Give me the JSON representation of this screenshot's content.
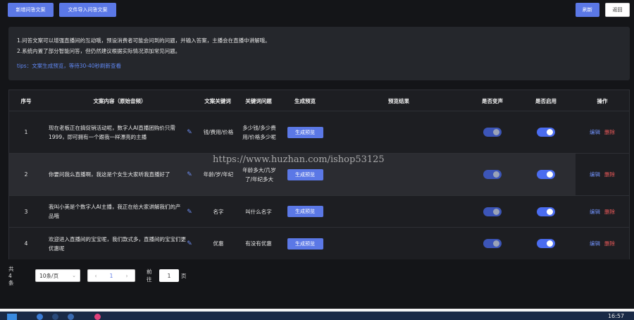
{
  "toolbar": {
    "add_label": "新增问答文案",
    "import_label": "文件导入问答文案",
    "refresh_label": "刷新",
    "back_label": "返回"
  },
  "info": {
    "line1": "1.问答文案可以增强直播间的互动哦，预设消费者可能会问到的问题，并输入答案，主播会在直播中讲解哦。",
    "line2": "2.系统内置了部分智能问答，但仍然建议根据实际情况添加常见问题。",
    "tips": "tips：文案生成预览，等待30-40秒刷新查看"
  },
  "table": {
    "headers": [
      "序号",
      "文案内容（原始音频）",
      "文案关键词",
      "关键词问题",
      "生成预览",
      "预览结果",
      "是否变声",
      "是否启用",
      "操作"
    ],
    "rows": [
      {
        "index": "1",
        "content": "现在老板正在搞促销活动呢，数字人AI直播团购价只需1999，即可拥有一个跟我一样漂亮的主播",
        "keyword": "钱/费用/价格",
        "question": "多少钱/多少费用/价格多少呢",
        "preview_btn": "生成预览",
        "voice_change": false,
        "enabled": true
      },
      {
        "index": "2",
        "content": "你要问我么直播啊，我这是个女生大家听我直播好了",
        "keyword": "年龄/岁/年纪",
        "question": "年龄多大/几岁了/年纪多大",
        "preview_btn": "生成预览",
        "voice_change": false,
        "enabled": true
      },
      {
        "index": "3",
        "content": "我叫小美是个数字人AI主播，我正在给大家讲解我们的产品哦",
        "keyword": "名字",
        "question": "叫什么名字",
        "preview_btn": "生成预览",
        "voice_change": false,
        "enabled": true
      },
      {
        "index": "4",
        "content": "欢迎进入直播间的宝宝呢，我们款式多，直播间的宝宝们更优惠呢",
        "keyword": "优惠",
        "question": "有没有优惠",
        "preview_btn": "生成预览",
        "voice_change": false,
        "enabled": true
      }
    ],
    "edit_label": "编辑",
    "delete_label": "删除",
    "edit_icon": "pencil-icon"
  },
  "pagination": {
    "total_text": "共 4 条",
    "page_size": "10条/页",
    "prev": "‹",
    "current_page": "1",
    "next": "›",
    "goto_label": "前往",
    "goto_value": "1",
    "page_unit": "页"
  },
  "watermark": "https://www.huzhan.com/ishop53125",
  "taskbar": {
    "time": "16:57"
  },
  "colors": {
    "accent": "#5b78e6",
    "danger": "#ee5a5a",
    "background": "#141518",
    "panel": "#25272c"
  }
}
